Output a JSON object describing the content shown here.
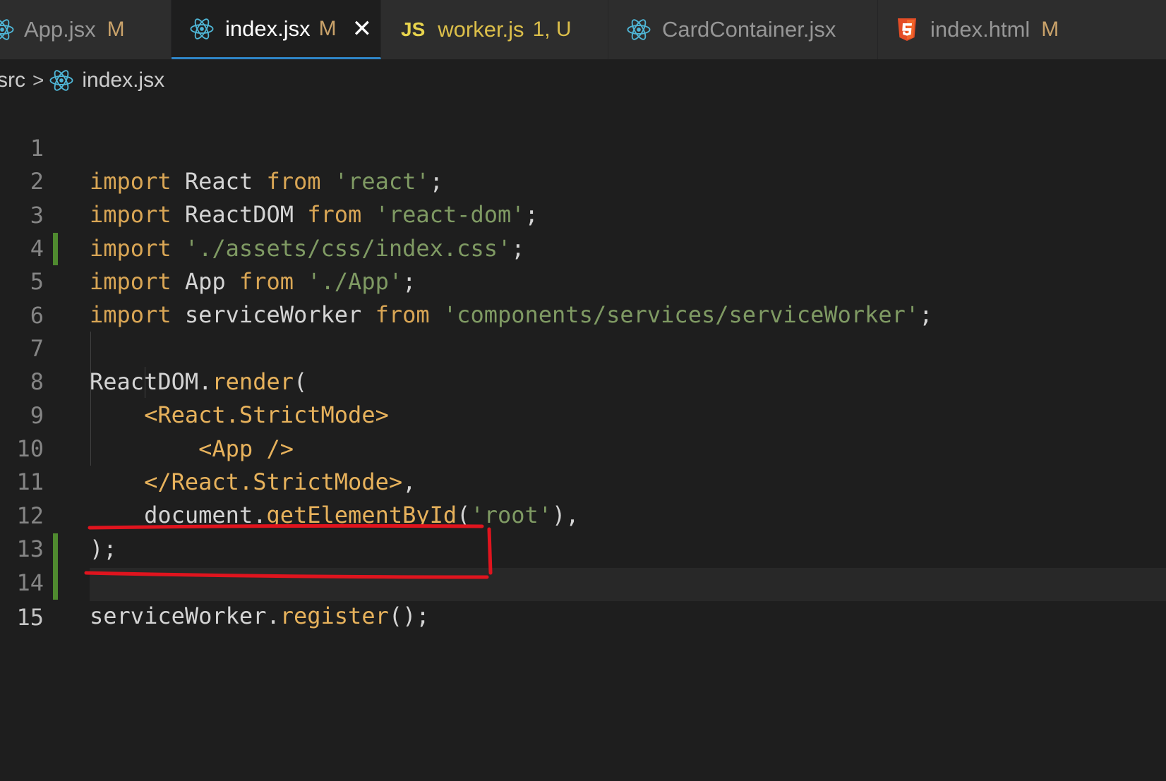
{
  "tabs": [
    {
      "label": "App.jsx",
      "status": "M",
      "icon": "react-icon"
    },
    {
      "label": "index.jsx",
      "status": "M",
      "icon": "react-icon",
      "active": true,
      "close": "✕"
    },
    {
      "label": "worker.js",
      "status": "1, U",
      "icon": "js-icon",
      "badge": "JS"
    },
    {
      "label": "CardContainer.jsx",
      "status": "",
      "icon": "react-icon"
    },
    {
      "label": "index.html",
      "status": "M",
      "icon": "html5-icon"
    }
  ],
  "breadcrumb": {
    "folder": "src",
    "separator": ">",
    "file": "index.jsx"
  },
  "line_numbers": [
    "1",
    "2",
    "3",
    "4",
    "5",
    "6",
    "7",
    "8",
    "9",
    "10",
    "11",
    "12",
    "13",
    "14",
    "15"
  ],
  "code": {
    "l1": {
      "k1": "import",
      "t1": " React ",
      "k2": "from",
      "t2": " ",
      "s1": "'react'",
      "t3": ";"
    },
    "l2": {
      "k1": "import",
      "t1": " ReactDOM ",
      "k2": "from",
      "t2": " ",
      "s1": "'react-dom'",
      "t3": ";"
    },
    "l3": {
      "k1": "import",
      "t1": " ",
      "s1": "'./assets/css/index.css'",
      "t3": ";"
    },
    "l4": {
      "k1": "import",
      "t1": " App ",
      "k2": "from",
      "t2": " ",
      "s1": "'./App'",
      "t3": ";"
    },
    "l5": {
      "k1": "import",
      "t1": " serviceWorker ",
      "k2": "from",
      "t2": " ",
      "s1": "'components/services/serviceWorker'",
      "t3": ";"
    },
    "l7": {
      "t1": "ReactDOM.",
      "f1": "render",
      "t2": "("
    },
    "l8": {
      "indent": "    ",
      "tg": "<React.StrictMode>"
    },
    "l9": {
      "indent": "        ",
      "tg": "<App />"
    },
    "l10": {
      "indent": "    ",
      "tg": "</React.StrictMode>",
      "t1": ","
    },
    "l11": {
      "indent": "    ",
      "t1": "document.",
      "f1": "getElementById",
      "t2": "(",
      "s1": "'root'",
      "t3": "),"
    },
    "l12": {
      "t1": ");"
    },
    "l14": {
      "t1": "serviceWorker.",
      "f1": "register",
      "t2": "();"
    }
  },
  "colors": {
    "background": "#1e1e1e",
    "tab_bar": "#2d2d2d",
    "active_tab_border": "#2f86c8",
    "keyword": "#d9a655",
    "string": "#7f9a63",
    "function": "#e7b25c",
    "git_modified_bar": "#4f8a2f",
    "annotation": "#e0141e"
  }
}
